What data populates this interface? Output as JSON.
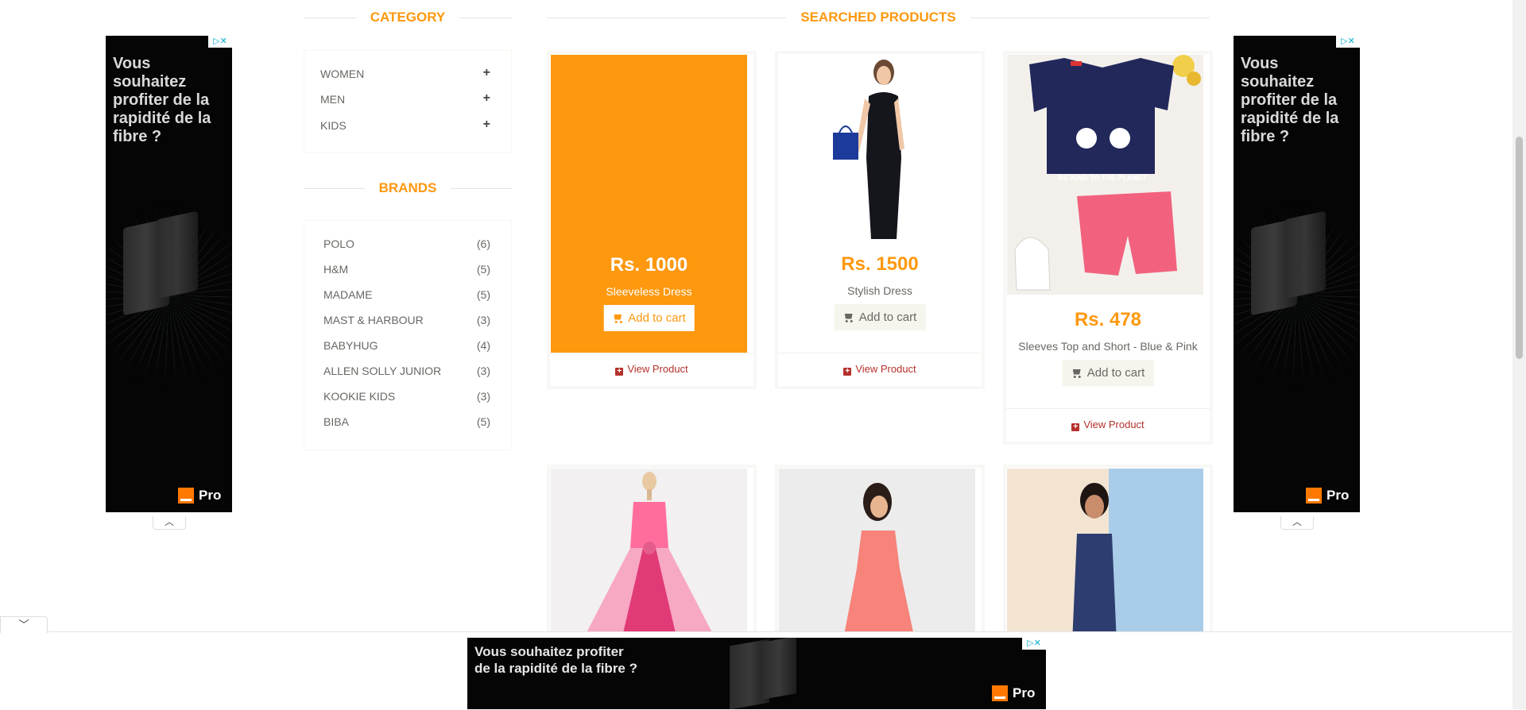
{
  "ads": {
    "side_text": "Vous souhaitez profiter de la rapidité de la fibre ?",
    "bottom_text_line1": "Vous souhaitez profiter",
    "bottom_text_line2": "de la rapidité de la fibre ?",
    "brand": "Pro",
    "accent_color": "#ff7900",
    "badge_icons": [
      "adchoices-icon",
      "close-icon"
    ]
  },
  "sidebar": {
    "category_title": "CATEGORY",
    "categories": [
      {
        "label": "WOMEN",
        "expand": "+"
      },
      {
        "label": "MEN",
        "expand": "+"
      },
      {
        "label": "KIDS",
        "expand": "+"
      }
    ],
    "brands_title": "BRANDS",
    "brands": [
      {
        "name": "POLO",
        "count": "(6)"
      },
      {
        "name": "H&M",
        "count": "(5)"
      },
      {
        "name": "MADAME",
        "count": "(5)"
      },
      {
        "name": "MAST & HARBOUR",
        "count": "(3)"
      },
      {
        "name": "BABYHUG",
        "count": "(4)"
      },
      {
        "name": "ALLEN SOLLY JUNIOR",
        "count": "(3)"
      },
      {
        "name": "KOOKIE KIDS",
        "count": "(3)"
      },
      {
        "name": "BIBA",
        "count": "(5)"
      }
    ]
  },
  "main": {
    "title": "SEARCHED PRODUCTS",
    "accent_color": "#fe980f",
    "products": [
      {
        "price": "Rs. 1000",
        "name": "Sleeveless Dress",
        "cart_label": "Add to cart",
        "view_label": "View Product",
        "hovered": true
      },
      {
        "price": "Rs. 1500",
        "name": "Stylish Dress",
        "cart_label": "Add to cart",
        "view_label": "View Product"
      },
      {
        "price": "Rs. 478",
        "name": "Sleeves Top and Short - Blue & Pink",
        "cart_label": "Add to cart",
        "view_label": "View Product",
        "image_text": "BE KIND TO THE PLANET"
      }
    ]
  }
}
